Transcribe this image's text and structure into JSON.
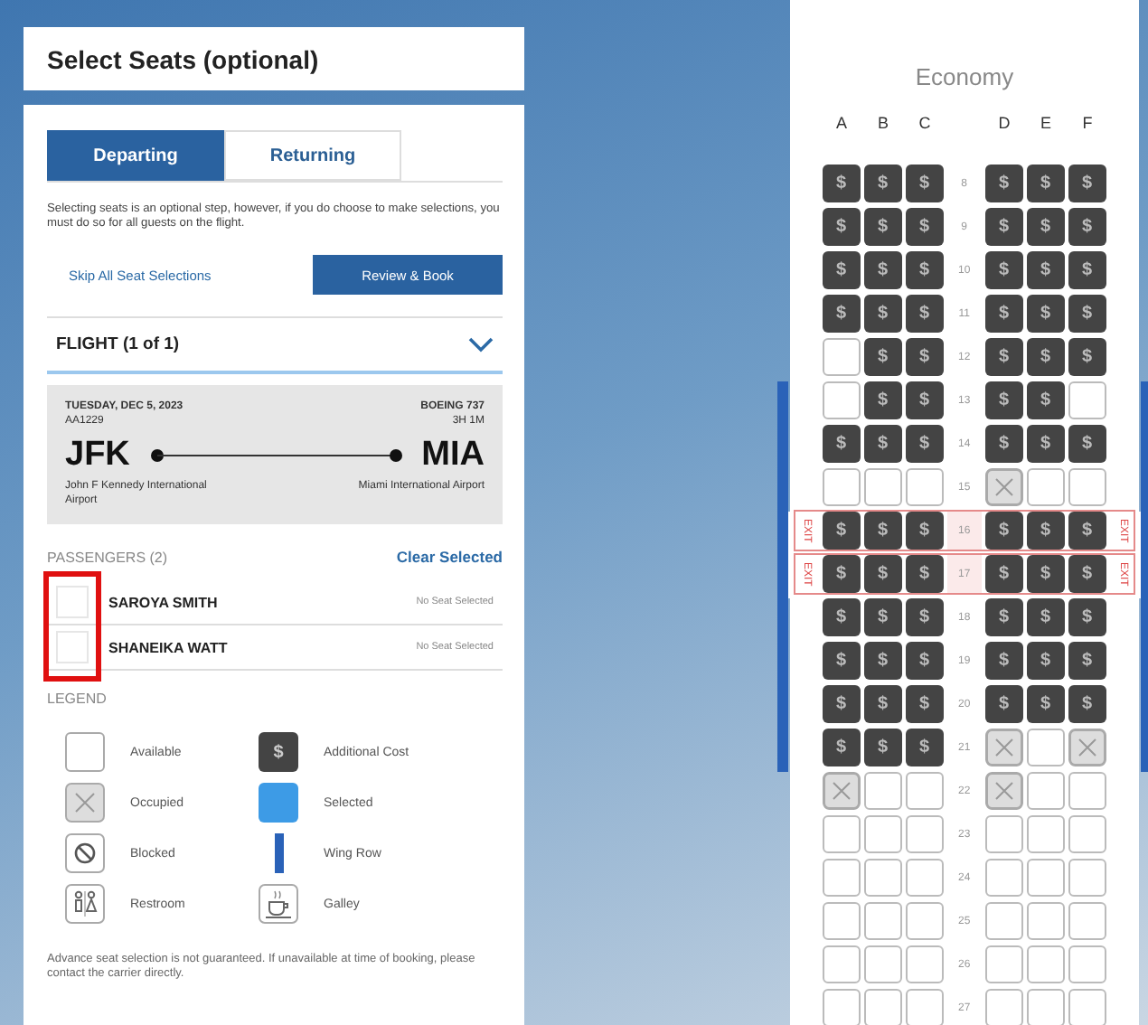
{
  "title": "Select Seats (optional)",
  "tabs": [
    {
      "label": "Departing",
      "selected": true
    },
    {
      "label": "Returning",
      "selected": false
    }
  ],
  "notice": "Selecting seats is an optional step, however, if you do choose to make selections, you must do so for all guests on the flight.",
  "skip_link": "Skip All Seat Selections",
  "review_button": "Review & Book",
  "flight": {
    "heading": "FLIGHT (1 of 1)",
    "date": "TUESDAY, DEC 5, 2023",
    "number": "AA1229",
    "aircraft": "BOEING 737",
    "duration": "3H 1M",
    "origin": "JFK",
    "origin_name": "John F Kennedy International Airport",
    "destination": "MIA",
    "destination_name": "Miami International Airport"
  },
  "passengers": {
    "heading": "PASSENGERS (2)",
    "clear_link": "Clear Selected",
    "highlighted": true,
    "list": [
      {
        "name": "SAROYA SMITH",
        "seat_status": "No Seat Selected"
      },
      {
        "name": "SHANEIKA WATT",
        "seat_status": "No Seat Selected"
      }
    ]
  },
  "legend": {
    "heading": "LEGEND",
    "items": [
      {
        "kind": "available",
        "label": "Available"
      },
      {
        "kind": "paid",
        "mark": "$",
        "label": "Additional Cost"
      },
      {
        "kind": "taken",
        "label": "Occupied"
      },
      {
        "kind": "selected",
        "label": "Selected"
      },
      {
        "kind": "blocked",
        "label": "Blocked"
      },
      {
        "kind": "wing",
        "label": "Wing Row"
      },
      {
        "kind": "restroom",
        "label": "Restroom"
      },
      {
        "kind": "galley",
        "label": "Galley"
      }
    ]
  },
  "disclaimer": "Advance seat selection is not guaranteed. If unavailable at time of booking, please contact the carrier directly.",
  "seat_map": {
    "cabin": "Economy",
    "columns": [
      "A",
      "B",
      "C",
      "D",
      "E",
      "F"
    ],
    "rows": [
      {
        "number": "8",
        "wing": false,
        "seats": [
          {
            "kind": "paid",
            "mark": "$"
          },
          {
            "kind": "paid",
            "mark": "$"
          },
          {
            "kind": "paid",
            "mark": "$"
          },
          {
            "kind": "paid",
            "mark": "$"
          },
          {
            "kind": "paid",
            "mark": "$"
          },
          {
            "kind": "paid",
            "mark": "$"
          }
        ]
      },
      {
        "number": "9",
        "wing": false,
        "seats": [
          {
            "kind": "paid",
            "mark": "$"
          },
          {
            "kind": "paid",
            "mark": "$"
          },
          {
            "kind": "paid",
            "mark": "$"
          },
          {
            "kind": "paid",
            "mark": "$"
          },
          {
            "kind": "paid",
            "mark": "$"
          },
          {
            "kind": "paid",
            "mark": "$"
          }
        ]
      },
      {
        "number": "10",
        "wing": false,
        "seats": [
          {
            "kind": "paid",
            "mark": "$"
          },
          {
            "kind": "paid",
            "mark": "$"
          },
          {
            "kind": "paid",
            "mark": "$"
          },
          {
            "kind": "paid",
            "mark": "$"
          },
          {
            "kind": "paid",
            "mark": "$"
          },
          {
            "kind": "paid",
            "mark": "$"
          }
        ]
      },
      {
        "number": "11",
        "wing": false,
        "seats": [
          {
            "kind": "paid",
            "mark": "$"
          },
          {
            "kind": "paid",
            "mark": "$"
          },
          {
            "kind": "paid",
            "mark": "$"
          },
          {
            "kind": "paid",
            "mark": "$"
          },
          {
            "kind": "paid",
            "mark": "$"
          },
          {
            "kind": "paid",
            "mark": "$"
          }
        ]
      },
      {
        "number": "12",
        "wing": false,
        "seats": [
          {
            "kind": "open"
          },
          {
            "kind": "paid",
            "mark": "$"
          },
          {
            "kind": "paid",
            "mark": "$"
          },
          {
            "kind": "paid",
            "mark": "$"
          },
          {
            "kind": "paid",
            "mark": "$"
          },
          {
            "kind": "paid",
            "mark": "$"
          }
        ]
      },
      {
        "number": "13",
        "wing": true,
        "seats": [
          {
            "kind": "open"
          },
          {
            "kind": "paid",
            "mark": "$"
          },
          {
            "kind": "paid",
            "mark": "$"
          },
          {
            "kind": "paid",
            "mark": "$"
          },
          {
            "kind": "paid",
            "mark": "$"
          },
          {
            "kind": "open"
          }
        ]
      },
      {
        "number": "14",
        "wing": true,
        "seats": [
          {
            "kind": "paid",
            "mark": "$"
          },
          {
            "kind": "paid",
            "mark": "$"
          },
          {
            "kind": "paid",
            "mark": "$"
          },
          {
            "kind": "paid",
            "mark": "$"
          },
          {
            "kind": "paid",
            "mark": "$"
          },
          {
            "kind": "paid",
            "mark": "$"
          }
        ]
      },
      {
        "number": "15",
        "wing": true,
        "seats": [
          {
            "kind": "open"
          },
          {
            "kind": "open"
          },
          {
            "kind": "open"
          },
          {
            "kind": "taken"
          },
          {
            "kind": "open"
          },
          {
            "kind": "open"
          }
        ]
      },
      {
        "number": "16",
        "wing": true,
        "exit_labels": [
          "EXIT",
          "EXIT"
        ],
        "seats": [
          {
            "kind": "paid",
            "mark": "$"
          },
          {
            "kind": "paid",
            "mark": "$"
          },
          {
            "kind": "paid",
            "mark": "$"
          },
          {
            "kind": "paid",
            "mark": "$"
          },
          {
            "kind": "paid",
            "mark": "$"
          },
          {
            "kind": "paid",
            "mark": "$"
          }
        ]
      },
      {
        "number": "17",
        "wing": true,
        "exit_labels": [
          "EXIT",
          "EXIT"
        ],
        "seats": [
          {
            "kind": "paid",
            "mark": "$"
          },
          {
            "kind": "paid",
            "mark": "$"
          },
          {
            "kind": "paid",
            "mark": "$"
          },
          {
            "kind": "paid",
            "mark": "$"
          },
          {
            "kind": "paid",
            "mark": "$"
          },
          {
            "kind": "paid",
            "mark": "$"
          }
        ]
      },
      {
        "number": "18",
        "wing": true,
        "seats": [
          {
            "kind": "paid",
            "mark": "$"
          },
          {
            "kind": "paid",
            "mark": "$"
          },
          {
            "kind": "paid",
            "mark": "$"
          },
          {
            "kind": "paid",
            "mark": "$"
          },
          {
            "kind": "paid",
            "mark": "$"
          },
          {
            "kind": "paid",
            "mark": "$"
          }
        ]
      },
      {
        "number": "19",
        "wing": true,
        "seats": [
          {
            "kind": "paid",
            "mark": "$"
          },
          {
            "kind": "paid",
            "mark": "$"
          },
          {
            "kind": "paid",
            "mark": "$"
          },
          {
            "kind": "paid",
            "mark": "$"
          },
          {
            "kind": "paid",
            "mark": "$"
          },
          {
            "kind": "paid",
            "mark": "$"
          }
        ]
      },
      {
        "number": "20",
        "wing": true,
        "seats": [
          {
            "kind": "paid",
            "mark": "$"
          },
          {
            "kind": "paid",
            "mark": "$"
          },
          {
            "kind": "paid",
            "mark": "$"
          },
          {
            "kind": "paid",
            "mark": "$"
          },
          {
            "kind": "paid",
            "mark": "$"
          },
          {
            "kind": "paid",
            "mark": "$"
          }
        ]
      },
      {
        "number": "21",
        "wing": true,
        "seats": [
          {
            "kind": "paid",
            "mark": "$"
          },
          {
            "kind": "paid",
            "mark": "$"
          },
          {
            "kind": "paid",
            "mark": "$"
          },
          {
            "kind": "taken"
          },
          {
            "kind": "open"
          },
          {
            "kind": "taken"
          }
        ]
      },
      {
        "number": "22",
        "wing": false,
        "seats": [
          {
            "kind": "taken"
          },
          {
            "kind": "open"
          },
          {
            "kind": "open"
          },
          {
            "kind": "taken"
          },
          {
            "kind": "open"
          },
          {
            "kind": "open"
          }
        ]
      },
      {
        "number": "23",
        "wing": false,
        "seats": [
          {
            "kind": "open"
          },
          {
            "kind": "open"
          },
          {
            "kind": "open"
          },
          {
            "kind": "open"
          },
          {
            "kind": "open"
          },
          {
            "kind": "open"
          }
        ]
      },
      {
        "number": "24",
        "wing": false,
        "seats": [
          {
            "kind": "open"
          },
          {
            "kind": "open"
          },
          {
            "kind": "open"
          },
          {
            "kind": "open"
          },
          {
            "kind": "open"
          },
          {
            "kind": "open"
          }
        ]
      },
      {
        "number": "25",
        "wing": false,
        "seats": [
          {
            "kind": "open"
          },
          {
            "kind": "open"
          },
          {
            "kind": "open"
          },
          {
            "kind": "open"
          },
          {
            "kind": "open"
          },
          {
            "kind": "open"
          }
        ]
      },
      {
        "number": "26",
        "wing": false,
        "seats": [
          {
            "kind": "open"
          },
          {
            "kind": "open"
          },
          {
            "kind": "open"
          },
          {
            "kind": "open"
          },
          {
            "kind": "open"
          },
          {
            "kind": "open"
          }
        ]
      },
      {
        "number": "27",
        "wing": false,
        "seats": [
          {
            "kind": "open"
          },
          {
            "kind": "open"
          },
          {
            "kind": "open"
          },
          {
            "kind": "open"
          },
          {
            "kind": "open"
          },
          {
            "kind": "open"
          }
        ]
      }
    ]
  }
}
